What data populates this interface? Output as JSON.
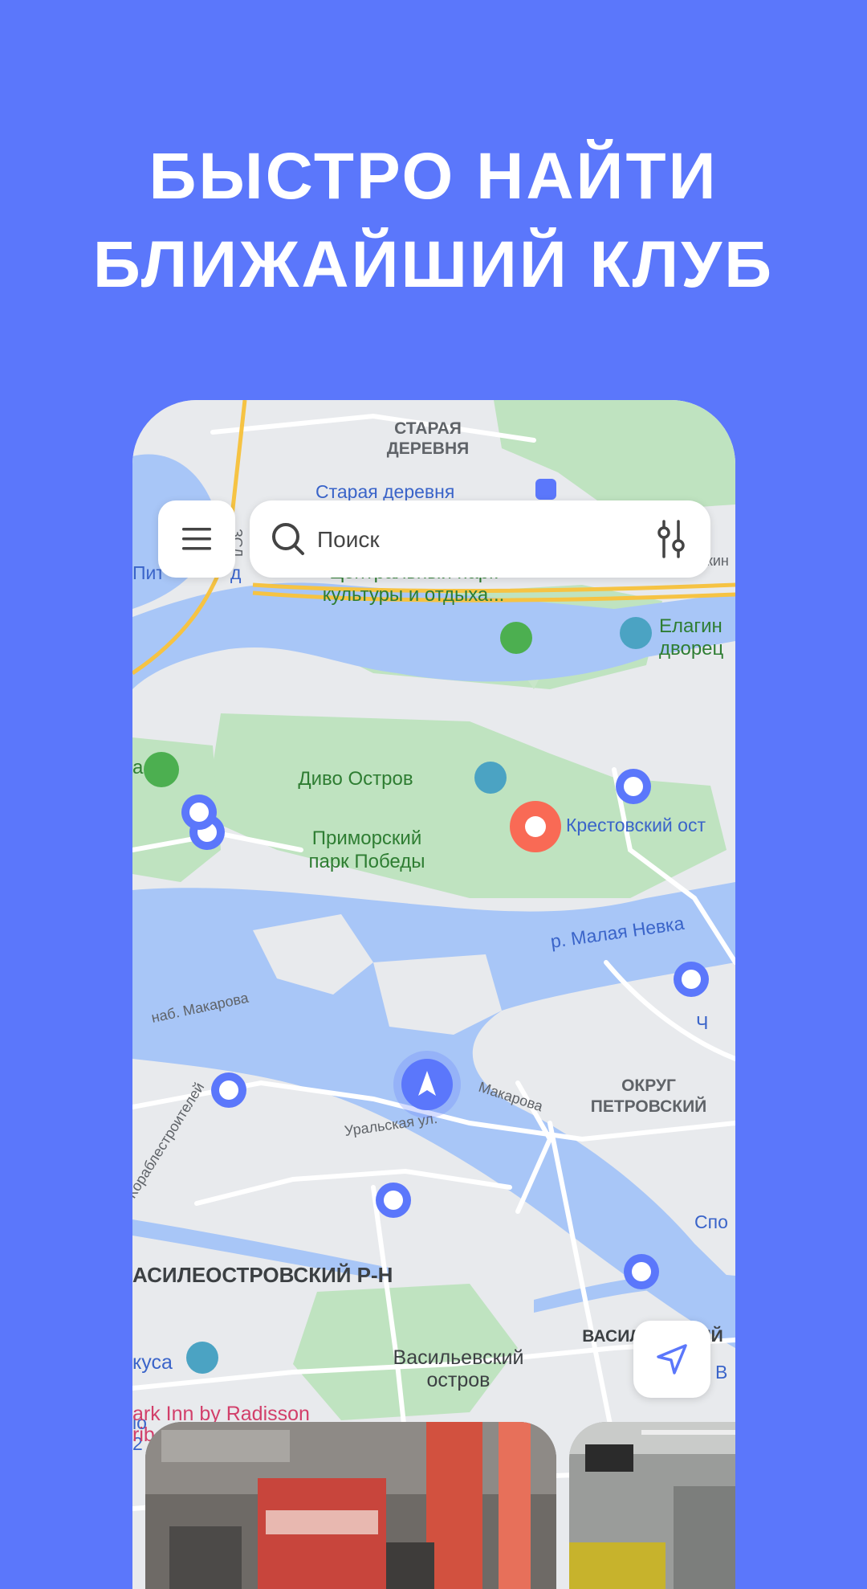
{
  "headline": {
    "line1": "БЫСТРО НАЙТИ",
    "line2": "БЛИЖАЙШИЙ КЛУБ"
  },
  "search": {
    "placeholder": "Поиск",
    "icon": "search-icon",
    "filter_icon": "filter-sliders-icon"
  },
  "menu": {
    "icon": "hamburger-menu-icon"
  },
  "location_button": {
    "icon": "navigation-arrow-icon"
  },
  "map_labels": {
    "staraya_derevnya_1": "СТАРАЯ",
    "staraya_derevnya_2": "ДЕРЕВНЯ",
    "metro_staraya": "Старая деревня",
    "central_park_1": "Центральный парк",
    "central_park_2": "культуры и отдыха...",
    "elagin_1": "Елагин",
    "elagin_2": "дворец",
    "divo": "Диво Остров",
    "primorsky_1": "Приморский",
    "primorsky_2": "парк Победы",
    "krestovsky": "Крестовский ост",
    "malaya_nevka": "р. Малая Невка",
    "nab_makarova": "наб. Макарова",
    "makarova": "Макарова",
    "uralskaya": "Уральская ул.",
    "okrug_1": "ОКРУГ",
    "okrug_2": "ПЕТРОВСКИЙ",
    "korablestroiteley": "Кораблестроителей",
    "vasileostrovsky_rn": "АСИЛЕОСТРОВСКИЙ Р-Н",
    "vasilevsky": "ВАСИЛЬЕВСКИЙ",
    "vasilevsky_ostrov_1": "Васильевский",
    "vasilevsky_ostrov_2": "остров",
    "park_inn": "ark Inn by Radisson",
    "park_inn_2": "rib",
    "vkusa": "куса",
    "pit": "Пит",
    "d": "д",
    "zsd": "ЗСД",
    "kin": "кин",
    "ch": "Ч",
    "spo": "Спо",
    "b": "В",
    "a": "а",
    "lo": "lo",
    "two": "2"
  },
  "colors": {
    "background": "#5B77FB",
    "marker_active": "#F96A55",
    "marker": "#5B77FB",
    "park": "#B8DEB8",
    "water": "#A8C6F7"
  }
}
